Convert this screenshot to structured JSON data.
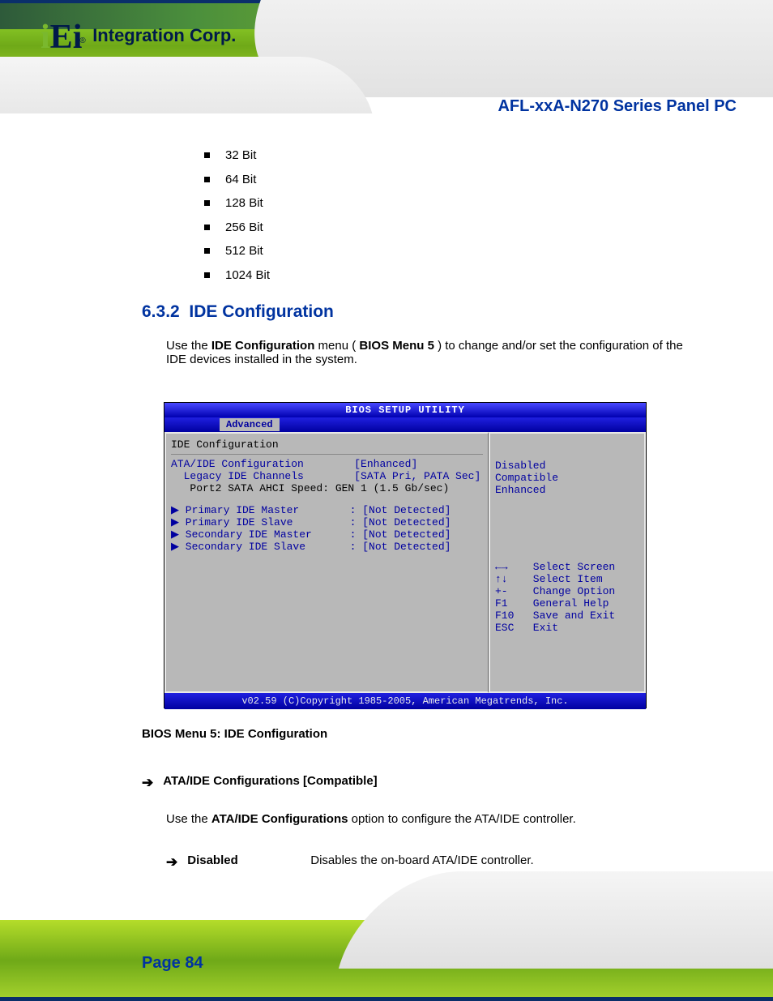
{
  "header": {
    "logo_text": "Integration Corp.",
    "product_title": "AFL-xxA-N270 Series Panel PC"
  },
  "bullets": [
    "32 Bit",
    "64 Bit",
    "128 Bit",
    "256 Bit",
    "512 Bit",
    "1024 Bit"
  ],
  "section": {
    "number": "6.3.2",
    "title": "IDE Configuration",
    "desc_prefix": "Use the ",
    "desc_link": "IDE Configuration",
    "desc_suffix": " menu (",
    "desc_ref": "BIOS Menu 5",
    "desc_tail": ") to change and/or set the configuration of the",
    "desc_line2": "IDE devices installed in the system."
  },
  "bios": {
    "title": "BIOS SETUP UTILITY",
    "tab": "Advanced",
    "left": {
      "section_title": "IDE Configuration",
      "row1": "ATA/IDE Configuration        [Enhanced]",
      "row2": "  Legacy IDE Channels        [SATA Pri, PATA Sec]",
      "row3": "   Port2 SATA AHCI Speed: GEN 1 (1.5 Gb/sec)",
      "row4": "▶ Primary IDE Master        : [Not Detected]",
      "row5": "▶ Primary IDE Slave         : [Not Detected]",
      "row6": "▶ Secondary IDE Master      : [Not Detected]",
      "row7": "▶ Secondary IDE Slave       : [Not Detected]"
    },
    "right": {
      "opt1": "Disabled",
      "opt2": "Compatible",
      "opt3": "Enhanced",
      "help1": "←→    Select Screen",
      "help2": "↑↓    Select Item",
      "help3": "+-    Change Option",
      "help4": "F1    General Help",
      "help5": "F10   Save and Exit",
      "help6": "ESC   Exit"
    },
    "footer": "v02.59 (C)Copyright 1985-2005, American Megatrends, Inc."
  },
  "figure_caption": "BIOS Menu 5: IDE Configuration",
  "config_item": {
    "label": "ATA/IDE Configurations [Compatible]",
    "desc_prefix": "Use the ",
    "desc_bold": "ATA/IDE Configurations",
    "desc_suffix": " option to configure the ATA/IDE controller.",
    "option_label": "Disabled",
    "option_text": "Disables the on-board ATA/IDE controller."
  },
  "page_number": "Page 84"
}
